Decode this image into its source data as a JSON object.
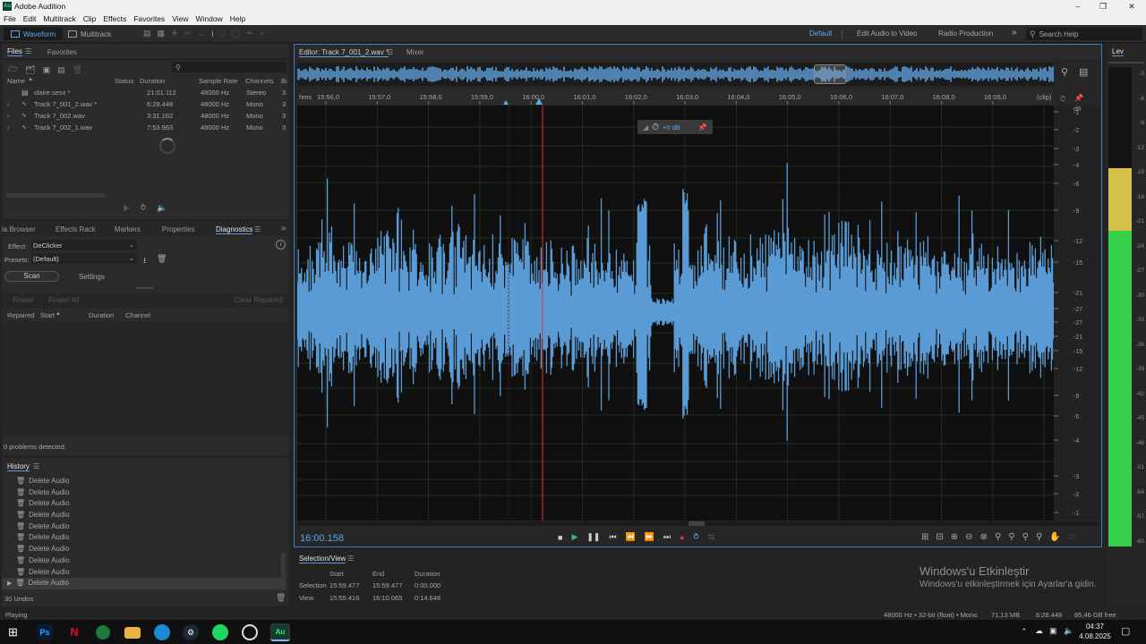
{
  "app": {
    "title": "Adobe Audition",
    "logo_text": "Au"
  },
  "menu": [
    "File",
    "Edit",
    "Multitrack",
    "Clip",
    "Effects",
    "Favorites",
    "View",
    "Window",
    "Help"
  ],
  "toolbar": {
    "waveform": "Waveform",
    "multitrack": "Multitrack",
    "workspaces": [
      "Default",
      "Edit Audio to Video",
      "Radio Production"
    ],
    "search_placeholder": "Search Help"
  },
  "files": {
    "tabs": [
      "Files",
      "Favorites"
    ],
    "columns": [
      "Name",
      "Status",
      "Duration",
      "Sample Rate",
      "Channels",
      "Bi"
    ],
    "rows": [
      {
        "name": "claire.sesx *",
        "duration": "21:01.112",
        "rate": "48000 Hz",
        "channels": "Stereo",
        "bits": "3",
        "active": false
      },
      {
        "name": "Track 7_001_2.wav *",
        "duration": "6:28.448",
        "rate": "48000 Hz",
        "channels": "Mono",
        "bits": "3",
        "active": true
      },
      {
        "name": "Track 7_002.wav",
        "duration": "3:31.162",
        "rate": "48000 Hz",
        "channels": "Mono",
        "bits": "3",
        "active": false
      },
      {
        "name": "Track 7_002_1.wav",
        "duration": "7:53.963",
        "rate": "48000 Hz",
        "channels": "Mono",
        "bits": "3",
        "active": false
      }
    ]
  },
  "diag": {
    "tabs": [
      "ia Browser",
      "Effects Rack",
      "Markers",
      "Properties",
      "Diagnostics"
    ],
    "effect_label": "Effect:",
    "effect_value": "DeClicker",
    "presets_label": "Presets:",
    "presets_value": "(Default)",
    "scan": "Scan",
    "settings": "Settings",
    "repair": "Repair",
    "repair_all": "Repair All",
    "clear_repaired": "Clear Repaired",
    "columns": [
      "Repaired",
      "Start",
      "Duration",
      "Channel"
    ],
    "problems": "0 problems detected."
  },
  "history": {
    "title": "History",
    "items": [
      "Delete Audio",
      "Delete Audio",
      "Delete Audio",
      "Delete Audio",
      "Delete Audio",
      "Delete Audio",
      "Delete Audio",
      "Delete Audio",
      "Delete Audio",
      "Delete Audio"
    ],
    "undos": "30 Undos"
  },
  "editor": {
    "tab": "Editor: Track 7_001_2.wav *",
    "mixer": "Mixer",
    "ruler": [
      "hms",
      "15:56,0",
      "15:57,0",
      "15:58,0",
      "15:59,0",
      "16:00,0",
      "16:01,0",
      "16:02,0",
      "16:03,0",
      "16:04,0",
      "16:05,0",
      "16:06,0",
      "16:07,0",
      "16:08,0",
      "16:09,0",
      "(clip)"
    ],
    "hud_db": "+0 dB",
    "db_scale": [
      "dB",
      "-1",
      "-2",
      "-3",
      "-4",
      "-6",
      "-9",
      "-12",
      "-15",
      "-21",
      "-27",
      "-27",
      "-21",
      "-15",
      "-12",
      "-9",
      "-6",
      "-4",
      "-3",
      "-2",
      "-1"
    ],
    "time": "16:00.158"
  },
  "meter": {
    "title": "Lev",
    "labels": [
      "-3",
      "-6",
      "-9",
      "-12",
      "-15",
      "-18",
      "-21",
      "-24",
      "-27",
      "-30",
      "-33",
      "-36",
      "-39",
      "-42",
      "-45",
      "-48",
      "-51",
      "-54",
      "-57",
      "-60"
    ],
    "peak_fraction": 0.79,
    "green_fraction": 0.66
  },
  "selview": {
    "title": "Selection/View",
    "headers": [
      "Start",
      "End",
      "Duration"
    ],
    "selection": {
      "label": "Selection",
      "start": "15:59.477",
      "end": "15:59.477",
      "duration": "0:00.000"
    },
    "view": {
      "label": "View",
      "start": "15:55.416",
      "end": "16:10.065",
      "duration": "0:14.648"
    }
  },
  "watermark": {
    "line1": "Windows'u Etkinleştir",
    "line2": "Windows'u etkinleştirmek için Ayarlar'a gidin."
  },
  "status": {
    "left": "Playing",
    "format": "48000 Hz • 32-bit (float) • Mono",
    "size": "71,13 MB",
    "duration": "6:28.448",
    "free": "85,46 GB free"
  },
  "taskbar": {
    "time": "04:37",
    "date": "4.08.2025",
    "ps": "Ps",
    "au": "Au"
  },
  "colors": {
    "wave": "#5b9bd5",
    "accent": "#5aa7f0",
    "play": "#39c26a",
    "record": "#e0353a",
    "meter_green": "#37d04a",
    "meter_yellow": "#d6c04a"
  }
}
